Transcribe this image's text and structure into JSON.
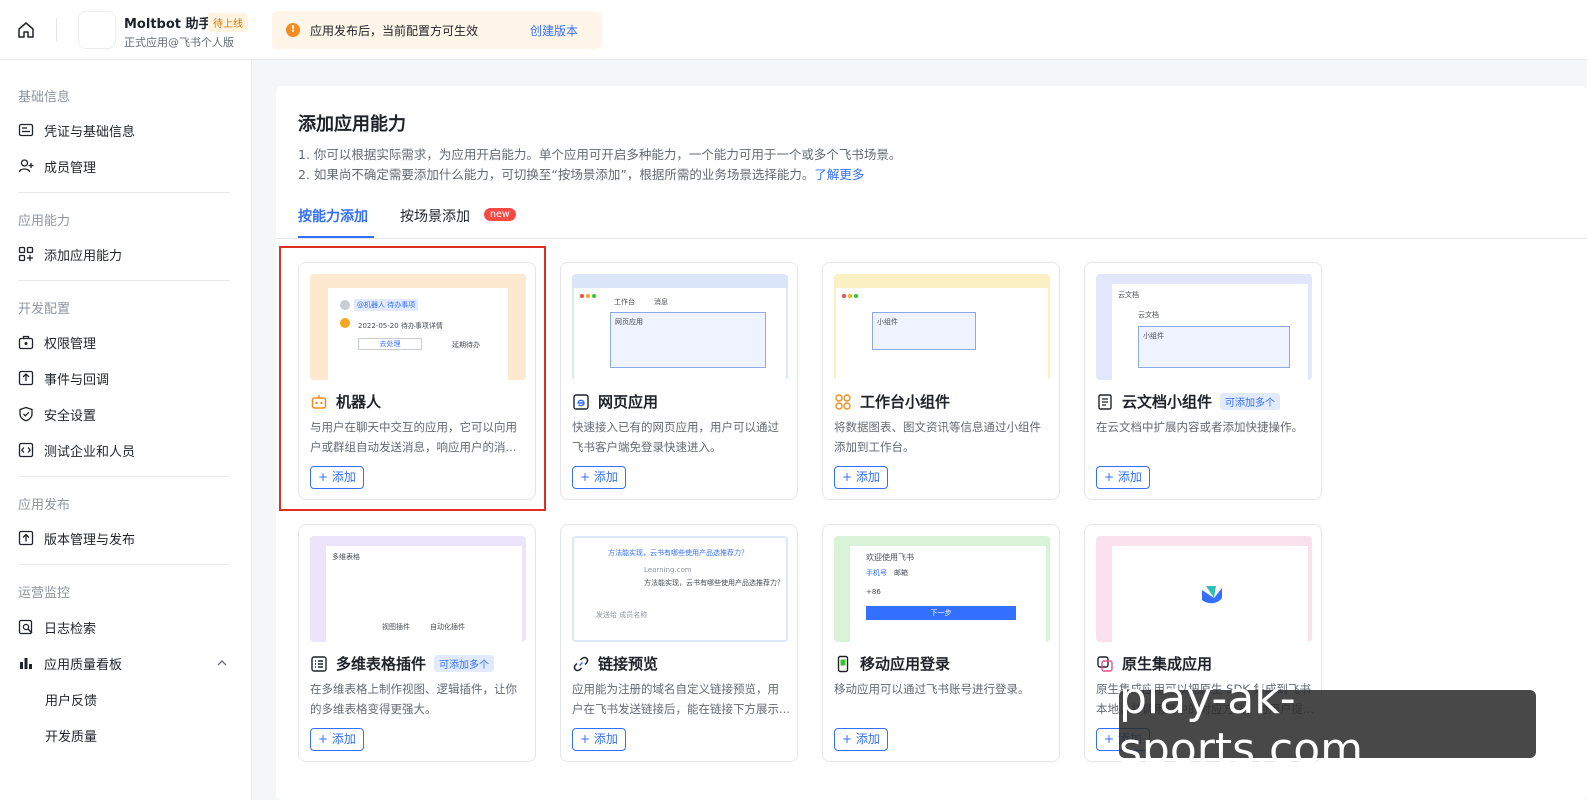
{
  "topbar": {
    "app_name": "Moltbot 助手",
    "app_badge": "待上线",
    "app_sub": "正式应用@飞书个人版",
    "notice_text": "应用发布后，当前配置方可生效",
    "notice_link": "创建版本"
  },
  "sidebar": {
    "sections": [
      {
        "title": "基础信息",
        "items": [
          "凭证与基础信息",
          "成员管理"
        ]
      },
      {
        "title": "应用能力",
        "items": [
          "添加应用能力"
        ]
      },
      {
        "title": "开发配置",
        "items": [
          "权限管理",
          "事件与回调",
          "安全设置",
          "测试企业和人员"
        ]
      },
      {
        "title": "应用发布",
        "items": [
          "版本管理与发布"
        ]
      },
      {
        "title": "运营监控",
        "items": [
          "日志检索",
          "应用质量看板"
        ]
      }
    ],
    "sub_items": [
      "用户反馈",
      "开发质量"
    ]
  },
  "main": {
    "title": "添加应用能力",
    "desc1": "1. 你可以根据实际需求，为应用开启能力。单个应用可开启多种能力，一个能力可用于一个或多个飞书场景。",
    "desc2": "2. 如果尚不确定需要添加什么能力，可切换至“按场景添加”，根据所需的业务场景选择能力。",
    "learn_more": "了解更多",
    "tabs": [
      "按能力添加",
      "按场景添加"
    ],
    "tab_new": "new",
    "add_label": "+ 添加",
    "cards": [
      {
        "title": "机器人",
        "tag": "",
        "desc": "与用户在聊天中交互的应用，它可以向用户或群组自动发送消息，响应用户的消..."
      },
      {
        "title": "网页应用",
        "tag": "",
        "desc": "快速接入已有的网页应用，用户可以通过飞书客户端免登录快速进入。"
      },
      {
        "title": "工作台小组件",
        "tag": "",
        "desc": "将数据图表、图文资讯等信息通过小组件添加到工作台。"
      },
      {
        "title": "云文档小组件",
        "tag": "可添加多个",
        "desc": "在云文档中扩展内容或者添加快捷操作。"
      },
      {
        "title": "多维表格插件",
        "tag": "可添加多个",
        "desc": "在多维表格上制作视图、逻辑插件，让你的多维表格变得更强大。"
      },
      {
        "title": "链接预览",
        "tag": "",
        "desc": "应用能为注册的域名自定义链接预览，用户在飞书发送链接后，能在链接下方展示..."
      },
      {
        "title": "移动应用登录",
        "tag": "",
        "desc": "移动应用可以通过飞书账号进行登录。"
      },
      {
        "title": "原生集成应用",
        "tag": "",
        "desc": "原生集成应用可以把原生 SDK 集成到飞书本地，并调用其中的对应方法，为用户提..."
      }
    ],
    "previews": {
      "robot_chip": "@机器人  待办事项",
      "robot_line": "2022-05-20  待办事项详情",
      "robot_btn1": "去处理",
      "robot_btn2": "延期待办",
      "web_tabs": "工作台",
      "web_tab2": "消息",
      "web_box": "网页应用",
      "widget_box": "小组件",
      "doc_back": "云文档",
      "doc_title": "云文档",
      "doc_box": "小组件",
      "base_title": "多维表格",
      "base_a": "视图插件",
      "base_b": "自动化插件",
      "link_q": "方法能实现，云书有哪些使用产品选推荐力？",
      "link_url": "Learning.com",
      "link_line": "方法能实现，云书有哪些使用产品选推荐力？",
      "link_input": "发送给 成员名称",
      "login_title": "欢迎使用飞书",
      "login_tab1": "手机号",
      "login_tab2": "邮箱",
      "login_code": "+86",
      "login_btn": "下一步"
    }
  },
  "watermark": "play-ak-sports.com",
  "colors": {
    "accent": "#3370ff",
    "highlight": "#e02e24",
    "warn": "#f58c1f"
  }
}
